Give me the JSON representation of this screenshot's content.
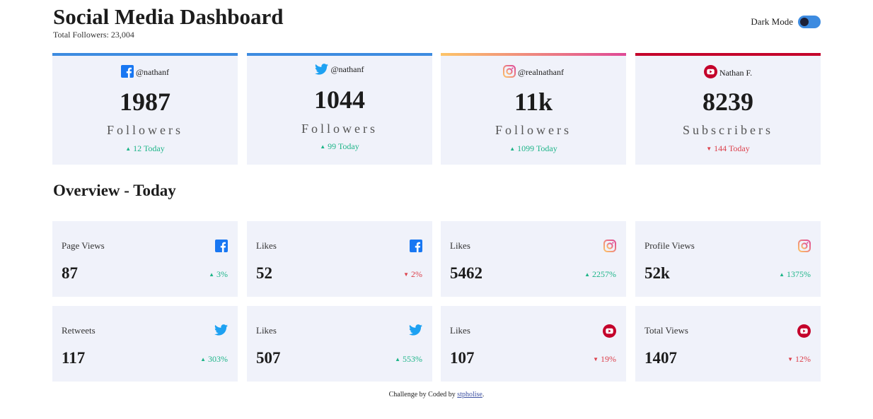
{
  "header": {
    "title": "Social Media Dashboard",
    "total_followers": "Total Followers: 23,004",
    "dark_mode_label": "Dark Mode"
  },
  "colors": {
    "facebook": "#1877f2",
    "twitter": "#1da1f2",
    "instagram_gradient": [
      "#fdc468",
      "#df4996"
    ],
    "youtube": "#c4032b",
    "up": "#1eb589",
    "down": "#dc414c"
  },
  "cards": [
    {
      "network": "facebook",
      "handle": "@nathanf",
      "count": "1987",
      "label": "Followers",
      "today": "12 Today",
      "trend": "up",
      "icon": "facebook-icon"
    },
    {
      "network": "twitter",
      "handle": "@nathanf",
      "count": "1044",
      "label": "Followers",
      "today": "99 Today",
      "trend": "up",
      "icon": "twitter-icon"
    },
    {
      "network": "instagram",
      "handle": "@realnathanf",
      "count": "11k",
      "label": "Followers",
      "today": "1099 Today",
      "trend": "up",
      "icon": "instagram-icon"
    },
    {
      "network": "youtube",
      "handle": "Nathan F.",
      "count": "8239",
      "label": "Subscribers",
      "today": "144 Today",
      "trend": "down",
      "icon": "youtube-icon"
    }
  ],
  "overview": {
    "title": "Overview - Today",
    "items": [
      {
        "label": "Page Views",
        "value": "87",
        "pct": "3%",
        "trend": "up",
        "icon": "facebook-icon"
      },
      {
        "label": "Likes",
        "value": "52",
        "pct": "2%",
        "trend": "down",
        "icon": "facebook-icon"
      },
      {
        "label": "Likes",
        "value": "5462",
        "pct": "2257%",
        "trend": "up",
        "icon": "instagram-icon"
      },
      {
        "label": "Profile Views",
        "value": "52k",
        "pct": "1375%",
        "trend": "up",
        "icon": "instagram-icon"
      },
      {
        "label": "Retweets",
        "value": "117",
        "pct": "303%",
        "trend": "up",
        "icon": "twitter-icon"
      },
      {
        "label": "Likes",
        "value": "507",
        "pct": "553%",
        "trend": "up",
        "icon": "twitter-icon"
      },
      {
        "label": "Likes",
        "value": "107",
        "pct": "19%",
        "trend": "down",
        "icon": "youtube-icon"
      },
      {
        "label": "Total Views",
        "value": "1407",
        "pct": "12%",
        "trend": "down",
        "icon": "youtube-icon"
      }
    ]
  },
  "footer": {
    "text": "Challenge by Coded by",
    "link_text": "stpholise",
    "end": "."
  }
}
